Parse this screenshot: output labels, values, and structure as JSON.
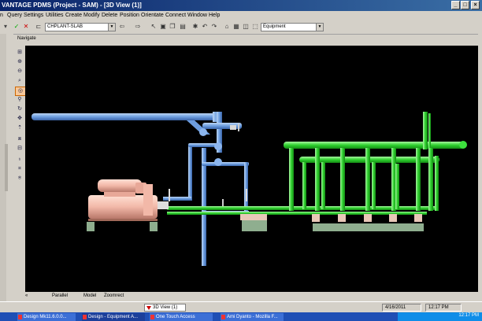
{
  "window": {
    "title": "VANTAGE PDMS (Project - SAM) - [3D View (1)]"
  },
  "menu": [
    "Query",
    "Settings",
    "Utilities",
    "Create",
    "Modify",
    "Delete",
    "Position",
    "Orientate",
    "Connect",
    "Window",
    "Help"
  ],
  "toolbar": {
    "element_combo": "CHPLANT-SLAB",
    "equipment_combo": "Equipment"
  },
  "navigate_label": "Navigate",
  "view_modes": [
    "Parallel",
    "Model",
    "Zoomrect"
  ],
  "status": {
    "view_tab": "3D View (1)",
    "date": "4/16/2011",
    "time": "12:17 PM"
  },
  "taskbar": {
    "items": [
      "Design Mk11.6.0.0...",
      "Design - Equipment A...",
      "One Touch Access",
      "Ami Dyanto - Mozilla F..."
    ],
    "clock": "12:17 PM"
  },
  "colors": {
    "viewport_bg": "#000000",
    "blue_pipe": "#6d9ee0",
    "green_pipe": "#2ed12e",
    "pump": "#f2b8a8",
    "support": "#8fae8f"
  }
}
